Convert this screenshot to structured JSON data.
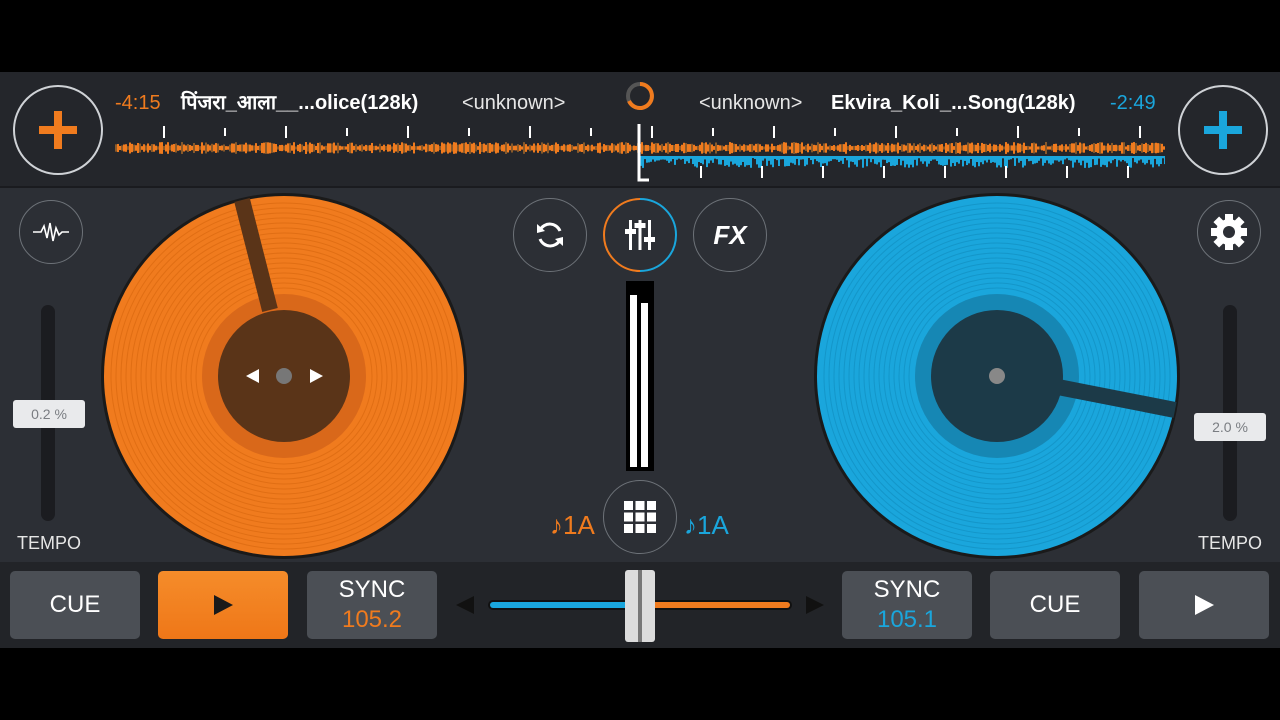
{
  "colors": {
    "deck_a": "#f07b1e",
    "deck_b": "#1aa6dc",
    "background": "#2c2f35",
    "button": "#4b4f55"
  },
  "deck_a": {
    "time_remaining": "-4:15",
    "title": "पिंजरा_आला__...olice(128k)",
    "artist": "<unknown>",
    "pitch": "0.2 %",
    "tempo_label": "TEMPO",
    "key": "♪1A",
    "cue_label": "CUE",
    "play_icon": "play-icon",
    "sync_label": "SYNC",
    "bpm": "105.2",
    "add_icon": "plus-icon"
  },
  "deck_b": {
    "time_remaining": "-2:49",
    "title": "Ekvira_Koli_...Song(128k)",
    "artist": "<unknown>",
    "pitch": "2.0 %",
    "tempo_label": "TEMPO",
    "key": "♪1A",
    "cue_label": "CUE",
    "play_icon": "play-icon",
    "sync_label": "SYNC",
    "bpm": "105.1",
    "add_icon": "plus-icon"
  },
  "center": {
    "loop_icon": "loop-icon",
    "mixer_icon": "mixer-icon",
    "fx_label": "FX",
    "sampler_icon": "grid-icon",
    "waveform_icon": "waveform-icon",
    "settings_icon": "gear-icon"
  }
}
